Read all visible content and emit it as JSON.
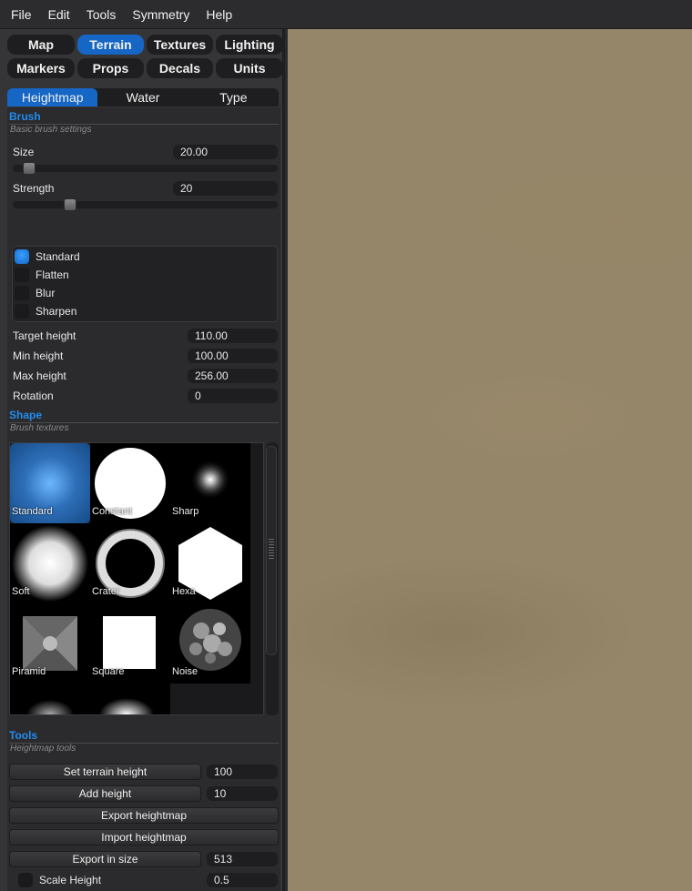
{
  "menu": [
    "File",
    "Edit",
    "Tools",
    "Symmetry",
    "Help"
  ],
  "modes": [
    {
      "label": "Map",
      "active": false
    },
    {
      "label": "Terrain",
      "active": true
    },
    {
      "label": "Textures",
      "active": false
    },
    {
      "label": "Lighting",
      "active": false
    },
    {
      "label": "Markers",
      "active": false
    },
    {
      "label": "Props",
      "active": false
    },
    {
      "label": "Decals",
      "active": false
    },
    {
      "label": "Units",
      "active": false
    }
  ],
  "subtabs": [
    {
      "label": "Heightmap",
      "active": true
    },
    {
      "label": "Water",
      "active": false
    },
    {
      "label": "Type",
      "active": false
    }
  ],
  "brush": {
    "title": "Brush",
    "subtitle": "Basic brush settings",
    "size_label": "Size",
    "size_value": "20.00",
    "strength_label": "Strength",
    "strength_value": "20",
    "modes": [
      {
        "label": "Standard",
        "checked": true
      },
      {
        "label": "Flatten",
        "checked": false
      },
      {
        "label": "Blur",
        "checked": false
      },
      {
        "label": "Sharpen",
        "checked": false
      }
    ],
    "target_height_label": "Target height",
    "target_height_value": "110.00",
    "min_height_label": "Min height",
    "min_height_value": "100.00",
    "max_height_label": "Max height",
    "max_height_value": "256.00",
    "rotation_label": "Rotation",
    "rotation_value": "0"
  },
  "shape": {
    "title": "Shape",
    "subtitle": "Brush textures",
    "textures": [
      "Standard",
      "Constant",
      "Sharp",
      "Soft",
      "Crater",
      "Hexa",
      "Piramid",
      "Square",
      "Noise"
    ],
    "selected": "Standard"
  },
  "tools": {
    "title": "Tools",
    "subtitle": "Heightmap tools",
    "set_height_label": "Set terrain height",
    "set_height_value": "100",
    "add_height_label": "Add height",
    "add_height_value": "10",
    "export_label": "Export heightmap",
    "import_label": "Import heightmap",
    "export_size_label": "Export in size",
    "export_size_value": "513",
    "scale_height_label": "Scale Height",
    "scale_height_value": "0.5"
  },
  "colors": {
    "accent": "#1566c5",
    "section_title": "#1f8cf0",
    "terrain": "#968669"
  }
}
